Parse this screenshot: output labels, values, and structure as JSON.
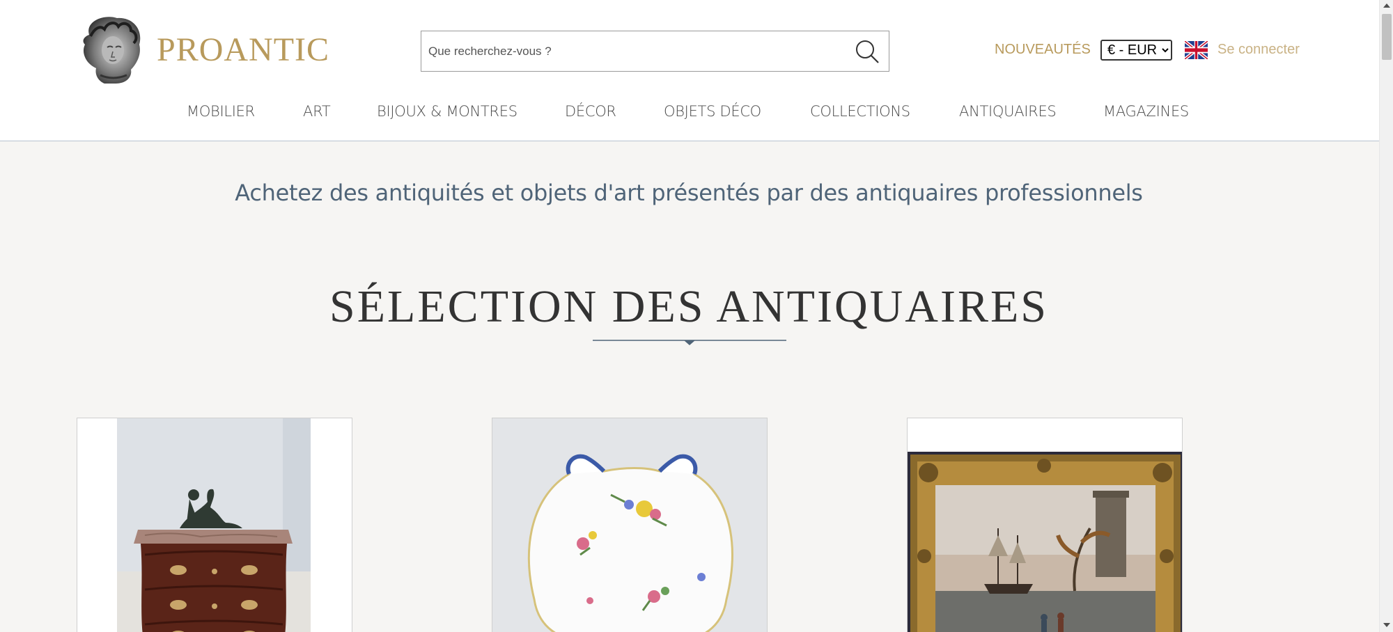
{
  "header": {
    "logo_text": "PROANTIC",
    "search_placeholder": "Que recherchez-vous ?",
    "nouveautes": "NOUVEAUTÉS",
    "currency_selected": "€ - EUR",
    "login": "Se connecter"
  },
  "nav": {
    "items": [
      "MOBILIER",
      "ART",
      "BIJOUX & MONTRES",
      "DÉCOR",
      "OBJETS DÉCO",
      "COLLECTIONS",
      "ANTIQUAIRES",
      "MAGAZINES"
    ]
  },
  "main": {
    "tagline": "Achetez des antiquités et objets d'art présentés par des antiquaires professionnels",
    "section_title": "SÉLECTION DES ANTIQUAIRES"
  },
  "colors": {
    "brand_gold": "#b89a5c",
    "tagline_blue": "#4f6478",
    "divider_blue": "#4f6478"
  },
  "icons": {
    "search": "search-icon",
    "flag": "uk-flag-icon",
    "logo": "logo-bust-icon"
  }
}
